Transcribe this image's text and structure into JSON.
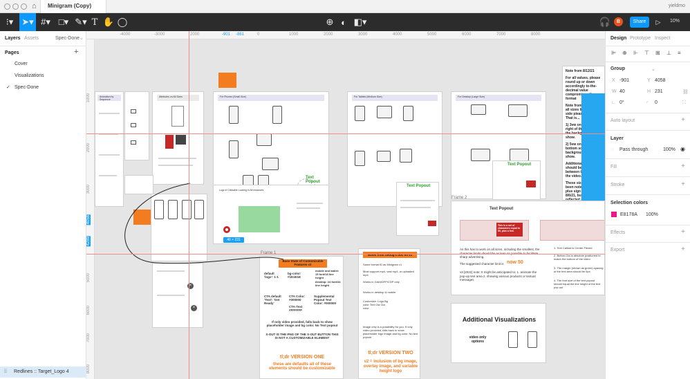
{
  "app": {
    "file_title": "Minigram (Copy)",
    "user": "yieldmo",
    "zoom": "10%",
    "share_label": "Share",
    "avatar_initial": "B",
    "accent": "#18a0fb",
    "share_color": "#0d99ff"
  },
  "left_panel": {
    "tabs": {
      "layers": "Layers",
      "assets": "Assets",
      "page_selector": "Spec-Done"
    },
    "pages_title": "Pages",
    "pages": [
      {
        "label": "Cover",
        "selected": false
      },
      {
        "label": "Visualizations",
        "selected": false
      },
      {
        "label": "Spec-Done",
        "selected": true
      }
    ],
    "footer_layer": "Redlines :: Target_Logo 4"
  },
  "right_panel": {
    "tabs": {
      "design": "Design",
      "prototype": "Prototype",
      "inspect": "Inspect"
    },
    "group": {
      "title": "Group",
      "x_label": "X",
      "x": "-901",
      "y_label": "Y",
      "y": "4058",
      "w_label": "W",
      "w": "40",
      "h_label": "H",
      "h": "231",
      "rotation": "0°",
      "radius": "0"
    },
    "auto_layout": "Auto layout",
    "layer": {
      "title": "Layer",
      "blend": "Pass through",
      "opacity": "100%"
    },
    "fill": "Fill",
    "stroke": "Stroke",
    "selection_colors": {
      "title": "Selection colors",
      "hex": "E8178A",
      "opacity": "100%",
      "swatch": "#e8178a"
    },
    "effects": "Effects",
    "export": "Export"
  },
  "rulers": {
    "h_ticks": [
      "-4000",
      "-3000",
      "2000",
      "-901",
      "-861",
      "0",
      "1000",
      "2000",
      "3000",
      "4000",
      "5000",
      "6000",
      "7000",
      "8000"
    ],
    "v_ticks": [
      "1000",
      "2000",
      "3000",
      "4058",
      "4289",
      "5000",
      "6000",
      "7000",
      "8000"
    ],
    "v_highlight_1": "4058",
    "v_highlight_2": "4289",
    "h_highlight_1": "-901",
    "h_highlight_2": "-861"
  },
  "canvas": {
    "selection_size": "40 × 231",
    "frame_labels": {
      "frame1": "Frame 1",
      "frame2": "Frame 2"
    },
    "frame_headers": [
      "Animation by Sequence",
      "Attributes on All Sizes",
      "For Phones (Small Size)",
      "For Tablets (Medium Size)",
      "For Desktop (Large Size)"
    ],
    "text_popout_1": "Text Popout",
    "text_popout_2": "Text Popout",
    "text_popout_3": "Text Popout",
    "text_popout_header": "Text Popout",
    "logo_frame_title": "Logo in Clickable Looking in All Instances",
    "notes_top_right": {
      "title": "Note from 8/12/21",
      "body_1": "For all values, please round up or down accordingly to-the-decimal value compromises the format",
      "body_2": "Note from 8/6/21 For all sizes listed to the side please add 0vw. That is...",
      "body_3": "1) 3vw on left and right of the video, so the background can show.",
      "body_4": "2) 5vw on the top and bottom so the background can show.",
      "body_5": "Additionally, there should be 3vw between the logo and the video.",
      "body_6": "These sizes have all been noted with the plus sign '+' after 8/6/21, but are not reflected so nothing is lost."
    },
    "base_state": {
      "title": "Base State of Customizable Features v2",
      "default_logo": "default 'logo': 1-1",
      "bg_color": "bg-color: #1E1E1E",
      "cta_default": "CTA default 'Text': 'Get Ready'",
      "cta_color": "CTA Color: #000000",
      "cta_text": "CTA-Text #FFFFFF",
      "popout_text_color": "Supplemental Popout Text Color: #000000",
      "mobile_tablet": "mobile and tablet: 15 font/18 line height",
      "desktop": "desktop: 24 font/34 line height",
      "fallback": "If only video provided, falls back to show placeholder image and bg color. No Text popout",
      "xout": "X-OUT IS THE PNG OF THE X-OUT BUTTON THIS IS NOT A CUSTOMIZABLE ELEMENT",
      "tldr": "tl;dr VERSION ONE",
      "tldr_sub": "these are defaults all of these elements should be customizable"
    },
    "notes_sebug": {
      "title": "Notes from Sebug's doc on v2",
      "line1": "Same format ID as Minigram v1",
      "line2": "Must support mp4, vast mp4, or uploaded mp4",
      "line3": "Works in GAM/DFP/CDP only",
      "line4": "Works in desktop & mobile",
      "customize": "Customize: Logo Bg color Text Cta Cta color",
      "fallback": "Image only is a possibility for you. If only video provided, falls back to show placeholder logo image and bg color. No text popout",
      "tldr": "tl;dr VERSION TWO",
      "tldr_sub": "v2 = inclusion of bg image, overlay image, and variable height logo"
    },
    "frame2": {
      "desc": "As this has to work on all sizes, including the smallest, the character limits should be as lean as possible to facilitate sharp advertising.",
      "char_limit": "The suggested character limit is",
      "char_num": "now 50",
      "v3_note": "v3 [2022] note: It might be anticipated to: 1. animate the pop-up text area 2. showing various products or textual messages",
      "callout_1": "1. Text Callout is Center Flexed",
      "callout_2": "2. Button-Cta is absolute positioned to match the bottom of the video",
      "callout_3": "3. The margin (shown as green) spacing of the text area should be 5px",
      "callout_4": "4. The font size of the text popout should equal the line height of the text pop out",
      "popout_msg": "This is a set of characters equal to 50, plus a few."
    },
    "additional_viz": {
      "title": "Additional Visualizations",
      "sub": "video only options"
    }
  }
}
